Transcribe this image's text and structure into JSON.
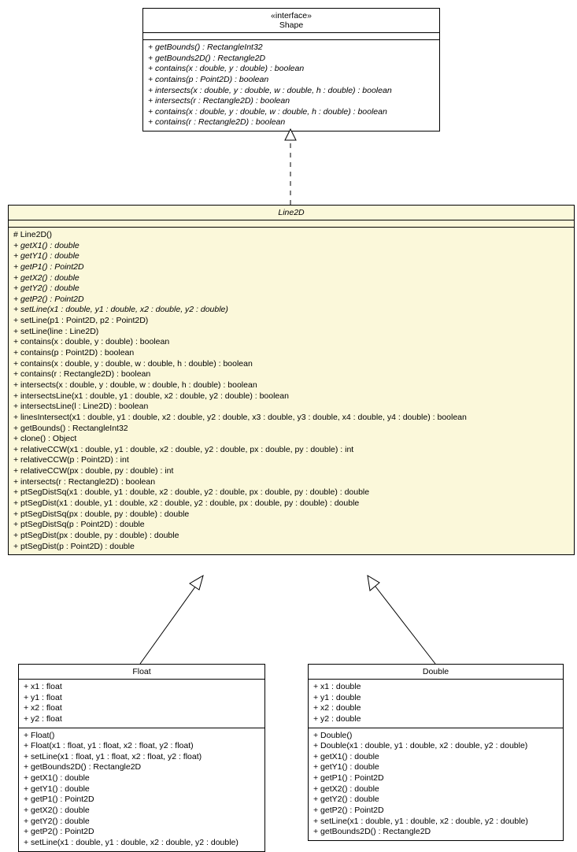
{
  "shape": {
    "stereotype": "«interface»",
    "name": "Shape",
    "methods": [
      {
        "t": "+ getBounds() : RectangleInt32",
        "i": true
      },
      {
        "t": "+ getBounds2D() : Rectangle2D",
        "i": true
      },
      {
        "t": "+ contains(x : double, y : double) : boolean",
        "i": true
      },
      {
        "t": "+ contains(p : Point2D) : boolean",
        "i": true
      },
      {
        "t": "+ intersects(x : double, y : double, w : double, h : double) : boolean",
        "i": true
      },
      {
        "t": "+ intersects(r : Rectangle2D) : boolean",
        "i": true
      },
      {
        "t": "+ contains(x : double, y : double, w : double, h : double) : boolean",
        "i": true
      },
      {
        "t": "+ contains(r : Rectangle2D) : boolean",
        "i": true
      }
    ]
  },
  "line2d": {
    "name": "Line2D",
    "methods": [
      {
        "t": "# Line2D()",
        "i": false
      },
      {
        "t": "+ getX1() : double",
        "i": true
      },
      {
        "t": "+ getY1() : double",
        "i": true
      },
      {
        "t": "+ getP1() : Point2D",
        "i": true
      },
      {
        "t": "+ getX2() : double",
        "i": true
      },
      {
        "t": "+ getY2() : double",
        "i": true
      },
      {
        "t": "+ getP2() : Point2D",
        "i": true
      },
      {
        "t": "+ setLine(x1 : double, y1 : double, x2 : double, y2 : double)",
        "i": true
      },
      {
        "t": "+ setLine(p1 : Point2D, p2 : Point2D)",
        "i": false
      },
      {
        "t": "+ setLine(line : Line2D)",
        "i": false
      },
      {
        "t": "+ contains(x : double, y : double) : boolean",
        "i": false
      },
      {
        "t": "+ contains(p : Point2D) : boolean",
        "i": false
      },
      {
        "t": "+ contains(x : double, y : double, w : double, h : double) : boolean",
        "i": false
      },
      {
        "t": "+ contains(r : Rectangle2D) : boolean",
        "i": false
      },
      {
        "t": "+ intersects(x : double, y : double, w : double, h : double) : boolean",
        "i": false
      },
      {
        "t": "+ intersectsLine(x1 : double, y1 : double, x2 : double, y2 : double) : boolean",
        "i": false
      },
      {
        "t": "+ intersectsLine(l : Line2D) : boolean",
        "i": false
      },
      {
        "t": "+ linesIntersect(x1 : double, y1 : double, x2 : double, y2 : double, x3 : double, y3 : double, x4 : double, y4 : double) : boolean",
        "i": false
      },
      {
        "t": "+ getBounds() : RectangleInt32",
        "i": false
      },
      {
        "t": "+ clone() : Object",
        "i": false
      },
      {
        "t": "+ relativeCCW(x1 : double, y1 : double, x2 : double, y2 : double, px : double, py : double) : int",
        "i": false
      },
      {
        "t": "+ relativeCCW(p : Point2D) : int",
        "i": false
      },
      {
        "t": "+ relativeCCW(px : double, py : double) : int",
        "i": false
      },
      {
        "t": "+ intersects(r : Rectangle2D) : boolean",
        "i": false
      },
      {
        "t": "+ ptSegDistSq(x1 : double, y1 : double, x2 : double, y2 : double, px : double, py : double) : double",
        "i": false
      },
      {
        "t": "+ ptSegDist(x1 : double, y1 : double, x2 : double, y2 : double, px : double, py : double) : double",
        "i": false
      },
      {
        "t": "+ ptSegDistSq(px : double, py : double) : double",
        "i": false
      },
      {
        "t": "+ ptSegDistSq(p : Point2D) : double",
        "i": false
      },
      {
        "t": "+ ptSegDist(px : double, py : double) : double",
        "i": false
      },
      {
        "t": "+ ptSegDist(p : Point2D) : double",
        "i": false
      }
    ]
  },
  "float": {
    "name": "Float",
    "fields": [
      "+ x1 : float",
      "+ y1 : float",
      "+ x2 : float",
      "+ y2 : float"
    ],
    "methods": [
      "+ Float()",
      "+ Float(x1 : float, y1 : float, x2 : float, y2 : float)",
      "+ setLine(x1 : float, y1 : float, x2 : float, y2 : float)",
      "+ getBounds2D() : Rectangle2D",
      "+ getX1() : double",
      "+ getY1() : double",
      "+ getP1() : Point2D",
      "+ getX2() : double",
      "+ getY2() : double",
      "+ getP2() : Point2D",
      "+ setLine(x1 : double, y1 : double, x2 : double, y2 : double)"
    ]
  },
  "double": {
    "name": "Double",
    "fields": [
      "+ x1 : double",
      "+ y1 : double",
      "+ x2 : double",
      "+ y2 : double"
    ],
    "methods": [
      "+ Double()",
      "+ Double(x1 : double, y1 : double, x2 : double, y2 : double)",
      "+ getX1() : double",
      "+ getY1() : double",
      "+ getP1() : Point2D",
      "+ getX2() : double",
      "+ getY2() : double",
      "+ getP2() : Point2D",
      "+ setLine(x1 : double, y1 : double, x2 : double, y2 : double)",
      "+ getBounds2D() : Rectangle2D"
    ]
  }
}
